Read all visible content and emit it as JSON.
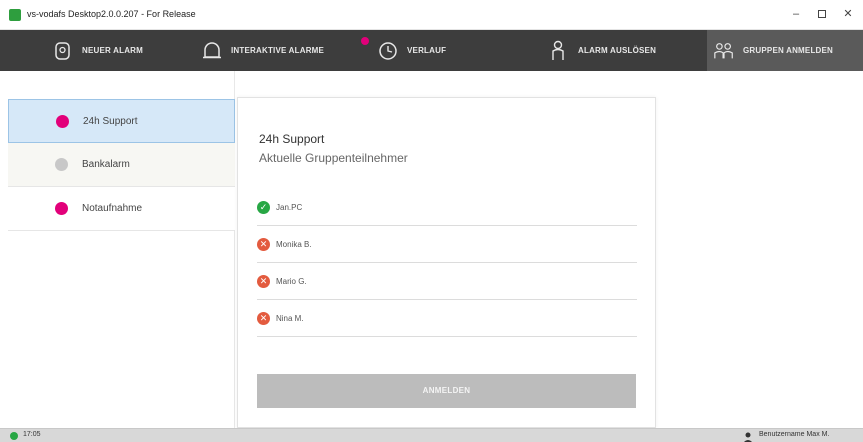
{
  "window": {
    "title": "vs-vodafs Desktop2.0.0.207 - For Release",
    "minimize_glyph": "–",
    "close_glyph": "✕"
  },
  "nav": {
    "items": [
      {
        "label": "NEUER ALARM",
        "icon": "alarm-bell-icon"
      },
      {
        "label": "INTERAKTIVE ALARME",
        "icon": "bell-icon",
        "badge": true
      },
      {
        "label": "VERLAUF",
        "icon": "history-clock-icon"
      },
      {
        "label": "ALARM AUSLÖSEN",
        "icon": "person-alert-icon"
      },
      {
        "label": "GRUPPEN ANMELDEN",
        "icon": "group-icon",
        "active": true
      }
    ]
  },
  "sidebar": {
    "groups": [
      {
        "label": "24h Support",
        "color": "#e2007a",
        "selected": true
      },
      {
        "label": "Bankalarm",
        "color": "#c8c8c8",
        "selected": false
      },
      {
        "label": "Notaufnahme",
        "color": "#e2007a",
        "selected": false
      }
    ]
  },
  "panel": {
    "title": "24h Support",
    "subtitle": "Aktuelle Gruppenteilnehmer",
    "members": [
      {
        "name": "Jan.PC",
        "status": "available"
      },
      {
        "name": "Monika B.",
        "status": "unavailable"
      },
      {
        "name": "Mario G.",
        "status": "unavailable"
      },
      {
        "name": "Nina M.",
        "status": "unavailable"
      }
    ],
    "status_glyphs": {
      "available": "✓",
      "unavailable": "✕"
    },
    "submit_label": "ANMELDEN"
  },
  "statusbar": {
    "time": "17:05",
    "user": "Benutzername Max M."
  },
  "colors": {
    "nav_bg": "#3d3d3d",
    "accent_magenta": "#e2007a",
    "ok_green": "#28a745",
    "error_red": "#e35b3f",
    "selected_bg": "#d6e8f8"
  }
}
